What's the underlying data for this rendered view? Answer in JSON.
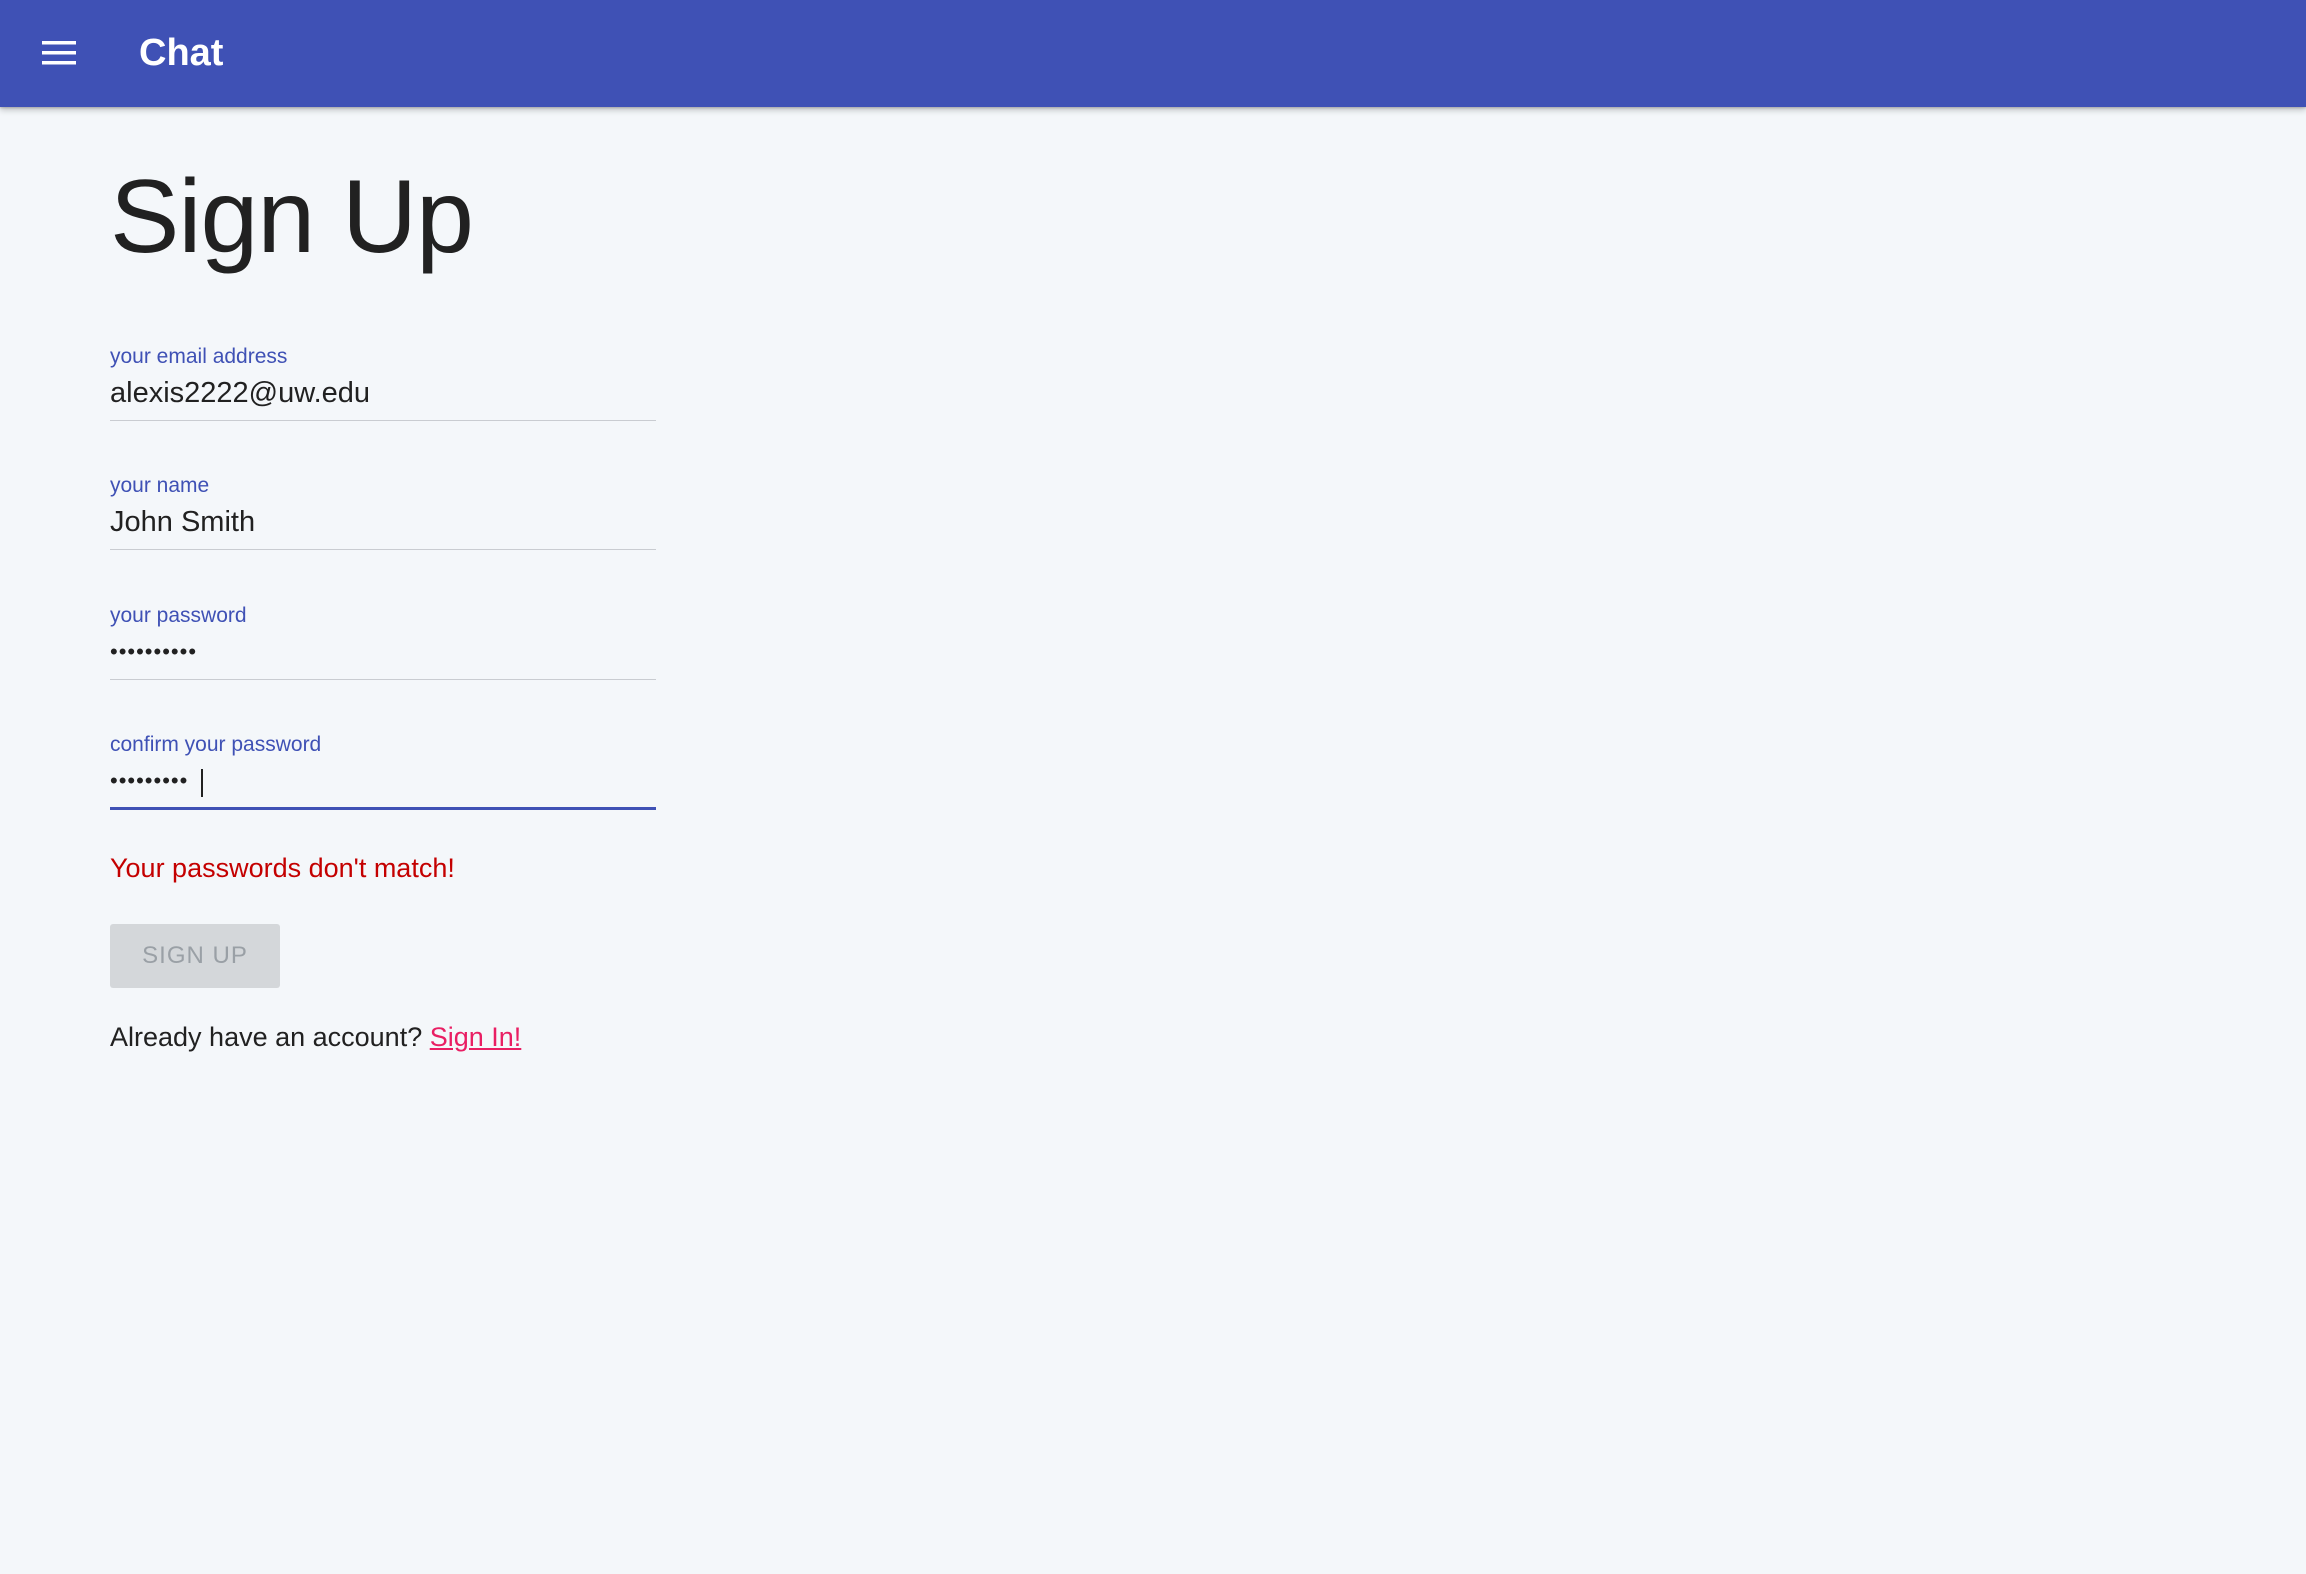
{
  "appbar": {
    "menu_icon": "hamburger-menu-icon",
    "title": "Chat",
    "color": "#3f51b5"
  },
  "page": {
    "title": "Sign Up"
  },
  "form": {
    "email": {
      "label": "your email address",
      "value": "alexis2222@uw.edu"
    },
    "name": {
      "label": "your name",
      "value": "John Smith"
    },
    "password": {
      "label": "your password",
      "value": "••••••••••"
    },
    "confirm_password": {
      "label": "confirm your password",
      "value": "•••••••••",
      "focused": true
    },
    "error": "Your passwords don't match!",
    "submit_label": "SIGN UP",
    "submit_disabled": true
  },
  "footer": {
    "prompt": "Already have an account?",
    "link_label": "Sign In!"
  },
  "colors": {
    "primary": "#3f51b5",
    "error": "#c40000",
    "link": "#e91e63",
    "background": "#f4f7fa"
  }
}
